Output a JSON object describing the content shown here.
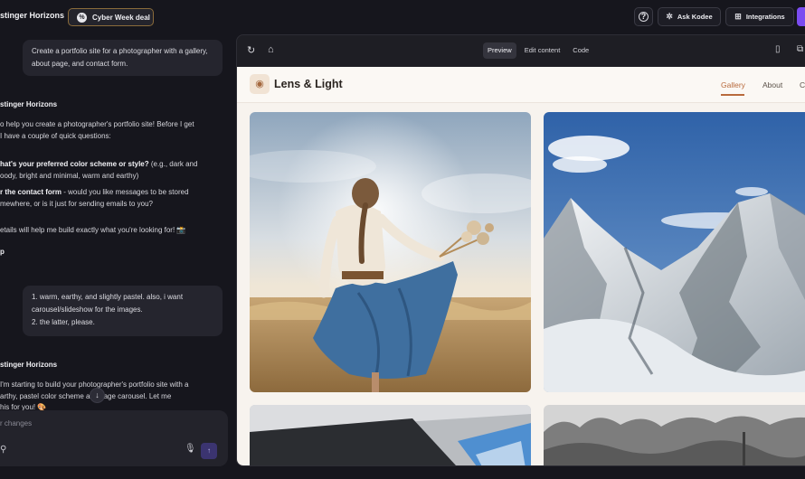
{
  "topbar": {
    "brand": "stinger Horizons",
    "deal_label": "Cyber Week deal",
    "ask_label": "Ask Kodee",
    "integrations_label": "Integrations"
  },
  "chat": {
    "user_message_1": "Create a portfolio site for a photographer with a gallery, about page, and contact form.",
    "author_1": "stinger Horizons",
    "reply_1_lines": [
      "o help you create a photographer's portfolio site! Before I get",
      "I have a couple of quick questions:"
    ],
    "q1_bold": "hat's your preferred color scheme or style?",
    "q1_rest": " (e.g., dark and",
    "q1_line2": "oody, bright and minimal, warm and earthy)",
    "q2_bold": "r the contact form",
    "q2_rest": " - would you like messages to be stored",
    "q2_line2": "mewhere, or is it just for sending emails to you?",
    "closing_line": "etails will help me build exactly what you're looking for! 📸",
    "stub": "p",
    "user_message_2_lines": [
      "1. warm, earthy, and slightly pastel. also, i want",
      "carousel/slideshow for the images.",
      "2. the latter, please."
    ],
    "author_2": "stinger Horizons",
    "reply_2_lines": [
      "I'm starting to build your photographer's portfolio site with a",
      "arthy, pastel color scheme       an image carousel. Let me",
      "his for you! 🎨"
    ],
    "composer_placeholder": "r changes"
  },
  "preview": {
    "tabs": [
      "Preview",
      "Edit content",
      "Code"
    ],
    "active_tab": "Preview",
    "site_name": "Lens & Light",
    "menu": [
      "Gallery",
      "About",
      "Co"
    ],
    "active_menu": "Gallery"
  },
  "colors": {
    "accent": "#b86a3c",
    "primary_button": "#7b4cf0",
    "deal_border": "#8a6b3a"
  },
  "icons": {
    "deal": "percent-badge-icon",
    "help": "help-circle-icon",
    "ask": "sparkle-icon",
    "integrations": "grid-icon",
    "refresh": "refresh-icon",
    "home": "home-icon",
    "mobile": "mobile-device-icon",
    "external": "external-link-icon",
    "camera": "camera-icon",
    "attach": "attach-icon",
    "mic": "microphone-icon",
    "send": "send-arrow-icon",
    "scroll": "arrow-down-icon"
  }
}
